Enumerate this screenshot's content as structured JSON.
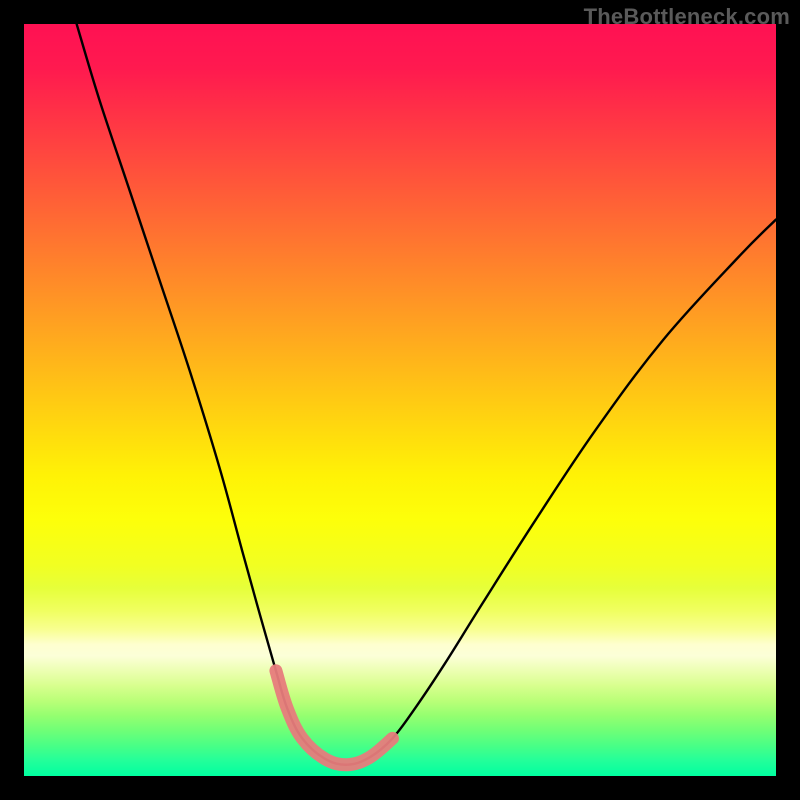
{
  "watermark": "TheBottleneck.com",
  "chart_data": {
    "type": "line",
    "title": "",
    "xlabel": "",
    "ylabel": "",
    "xlim": [
      0,
      100
    ],
    "ylim": [
      0,
      100
    ],
    "grid": false,
    "legend_position": "none",
    "annotations": [],
    "series": [
      {
        "name": "black-curve",
        "color": "#000000",
        "x": [
          7,
          10,
          14,
          18,
          22,
          26,
          29,
          31.5,
          33.5,
          35,
          37,
          40,
          43,
          46,
          49,
          52,
          56,
          61,
          68,
          76,
          85,
          95,
          100
        ],
        "y": [
          100,
          90,
          78,
          66,
          54,
          41,
          30,
          21,
          14,
          9,
          5,
          2.3,
          1.5,
          2.5,
          5,
          9,
          15,
          23,
          34,
          46,
          58,
          69,
          74
        ]
      },
      {
        "name": "pink-highlight",
        "color": "#e77c7c",
        "x": [
          33.5,
          35,
          37,
          40,
          43,
          46,
          49
        ],
        "y": [
          14,
          9,
          5,
          2.3,
          1.5,
          2.5,
          5
        ]
      }
    ],
    "gradient_background": {
      "orientation": "vertical",
      "stops": [
        {
          "pos": 0,
          "color": "#ff1153"
        },
        {
          "pos": 50,
          "color": "#ffd010"
        },
        {
          "pos": 75,
          "color": "#f6ff50"
        },
        {
          "pos": 84,
          "color": "#fcffd8"
        },
        {
          "pos": 100,
          "color": "#00ffa0"
        }
      ]
    }
  }
}
